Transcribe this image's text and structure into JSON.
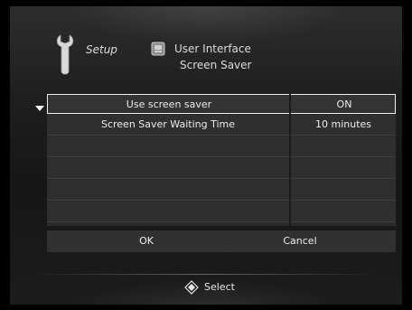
{
  "header": {
    "setup_label": "Setup",
    "user_interface_label": "User Interface",
    "screen_saver_label": "Screen Saver",
    "icons": [
      "wrench-icon",
      "user-interface-icon"
    ]
  },
  "settings": {
    "rows": [
      {
        "name": "Use screen saver",
        "value": "ON"
      },
      {
        "name": "Screen Saver Waiting Time",
        "value": "10 minutes"
      },
      {
        "name": "",
        "value": ""
      },
      {
        "name": "",
        "value": ""
      },
      {
        "name": "",
        "value": ""
      },
      {
        "name": "",
        "value": ""
      }
    ]
  },
  "buttons": {
    "ok_label": "OK",
    "cancel_label": "Cancel"
  },
  "footer": {
    "select_label": "Select",
    "icon": "directional-pad-icon"
  },
  "colors": {
    "background": "#1c1c1c",
    "row": "#2f2f2f",
    "highlight_border": "#f0f0f0",
    "text": "#ececec"
  }
}
